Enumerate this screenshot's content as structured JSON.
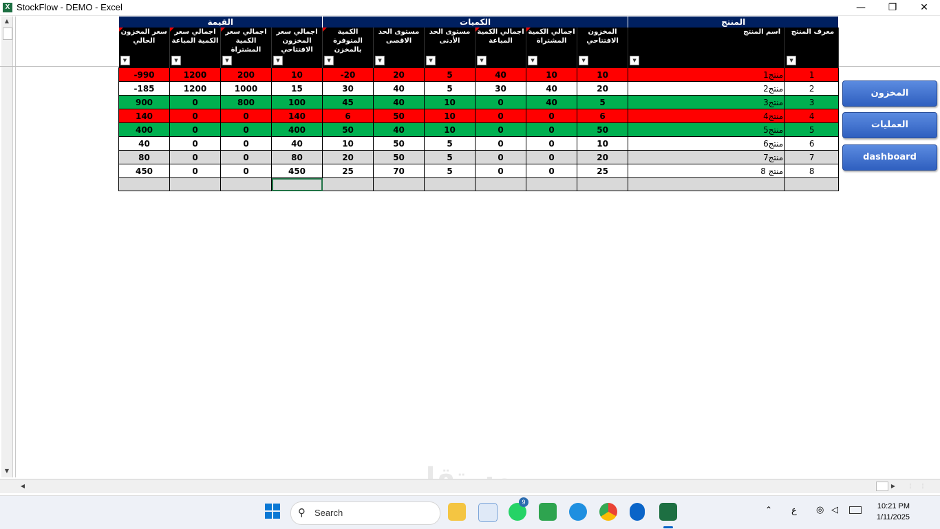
{
  "window": {
    "title": "StockFlow - DEMO - Excel",
    "minimize": "—",
    "restore": "❐",
    "close": "✕",
    "app_badge": "X"
  },
  "table": {
    "group_headers": {
      "value": "القيمة",
      "quantities": "الكميات",
      "product": "المنتج"
    },
    "columns": [
      "سعر المخزون الحالي",
      "اجمالي سعر الكمية المباعة",
      "اجمالي سعر الكمية المشتراة",
      "اجمالي سعر المخزون الافتتاحي",
      "الكمية المتوفرة بالمخزن",
      "مستوى الحد الاقصى",
      "مستوى الحد الأدنى",
      "اجمالي الكمية المباعة",
      "اجمالي الكمية المشتراة",
      "المخزون الافتتاحي",
      "اسم المنتج",
      "معرف المنتج"
    ],
    "rows": [
      {
        "status": "red",
        "cells": [
          "-990",
          "1200",
          "200",
          "10",
          "-20",
          "20",
          "5",
          "40",
          "10",
          "10",
          "منتج1",
          "1"
        ]
      },
      {
        "status": "white",
        "cells": [
          "-185",
          "1200",
          "1000",
          "15",
          "30",
          "40",
          "5",
          "30",
          "40",
          "20",
          "منتج2",
          "2"
        ]
      },
      {
        "status": "green",
        "cells": [
          "900",
          "0",
          "800",
          "100",
          "45",
          "40",
          "10",
          "0",
          "40",
          "5",
          "منتج3",
          "3"
        ]
      },
      {
        "status": "red",
        "cells": [
          "140",
          "0",
          "0",
          "140",
          "6",
          "50",
          "10",
          "0",
          "0",
          "6",
          "منتج4",
          "4"
        ]
      },
      {
        "status": "green",
        "cells": [
          "400",
          "0",
          "0",
          "400",
          "50",
          "40",
          "10",
          "0",
          "0",
          "50",
          "منتج5",
          "5"
        ]
      },
      {
        "status": "white",
        "cells": [
          "40",
          "0",
          "0",
          "40",
          "10",
          "50",
          "5",
          "0",
          "0",
          "10",
          "منتج6",
          "6"
        ]
      },
      {
        "status": "gray",
        "cells": [
          "80",
          "0",
          "0",
          "80",
          "20",
          "50",
          "5",
          "0",
          "0",
          "20",
          "منتج7",
          "7"
        ]
      },
      {
        "status": "white",
        "cells": [
          "450",
          "0",
          "0",
          "450",
          "25",
          "70",
          "5",
          "0",
          "0",
          "25",
          "منتج 8",
          "8"
        ]
      }
    ]
  },
  "buttons": {
    "inventory": "المخزون",
    "operations": "العمليات",
    "dashboard": "dashboard"
  },
  "taskbar": {
    "search_placeholder": "Search",
    "whatsapp_badge": "9",
    "lang": "ع",
    "time": "10:21 PM",
    "date": "1/11/2025"
  },
  "watermark": "مستقل",
  "colors": {
    "red": "#ff0000",
    "green": "#00b050",
    "header_navy": "#002060",
    "excel_green": "#217346"
  }
}
